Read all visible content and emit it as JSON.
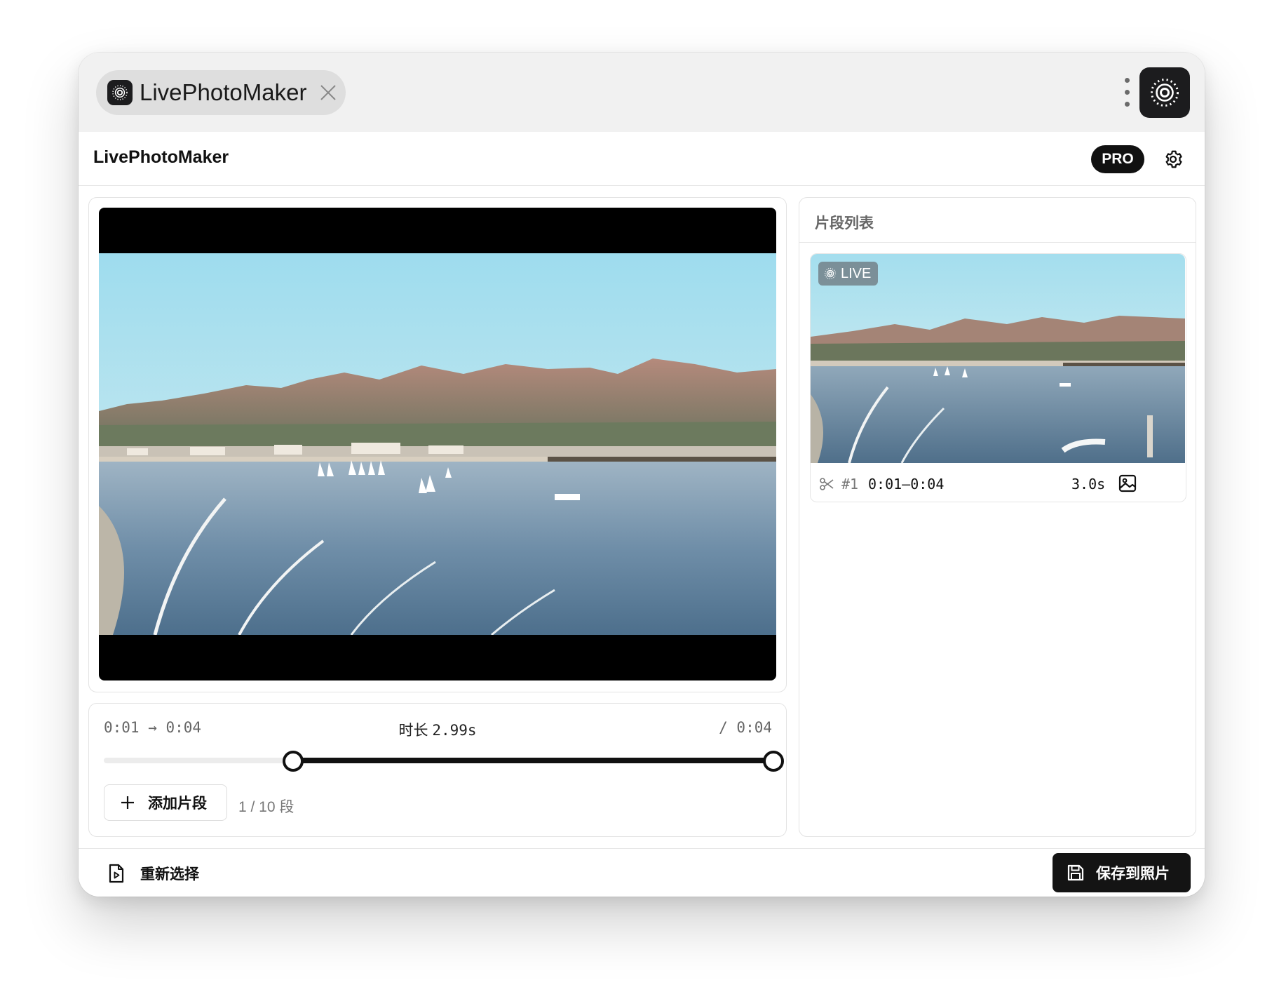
{
  "tab": {
    "title": "LivePhotoMaker",
    "icon": "live-photo-icon",
    "close_icon": "close-icon"
  },
  "titlebar": {
    "menu_icon": "kebab-menu-icon",
    "app_icon": "live-photo-icon"
  },
  "header": {
    "title": "LivePhotoMaker",
    "badge": "PRO",
    "settings_icon": "gear-icon"
  },
  "player": {
    "content": "video-frame-harbor-scene"
  },
  "controls": {
    "range": "0:01 → 0:04",
    "duration_label": "时长",
    "duration_value": "2.99s",
    "total": "/ 0:04",
    "slider": {
      "start_fraction": 0.283,
      "end_fraction": 1.0,
      "fill_color": "#111111"
    },
    "add_button": "添加片段",
    "segment_count": "1 / 10 段"
  },
  "segments": {
    "title": "片段列表",
    "items": [
      {
        "badge": "LIVE",
        "index": "#1",
        "range": "0:01–0:04",
        "duration": "3.0s"
      }
    ]
  },
  "footer": {
    "reselect": "重新选择",
    "save": "保存到照片"
  },
  "colors": {
    "accent": "#111111",
    "window_bg": "#ffffff",
    "tabbar_bg": "#f1f1f1"
  }
}
